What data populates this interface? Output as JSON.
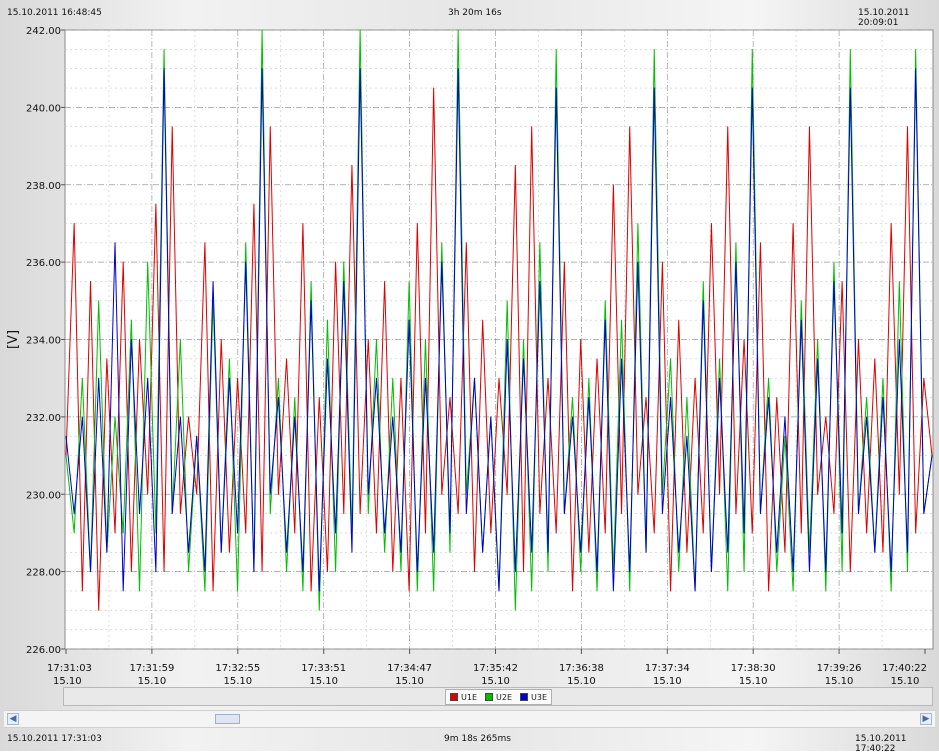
{
  "header": {
    "left_datetime": "15.10.2011 16:48:45",
    "center_duration": "3h 20m 16s",
    "right_datetime": "15.10.2011 20:09:01"
  },
  "footer": {
    "left_datetime": "15.10.2011 17:31:03",
    "center_duration": "9m 18s 265ms",
    "right_datetime": "15.10.2011 17:40:22"
  },
  "chart_data": {
    "type": "line",
    "ylabel": "[V]",
    "ylim": [
      226,
      242
    ],
    "yticks": [
      "226.00",
      "228.00",
      "230.00",
      "232.00",
      "234.00",
      "236.00",
      "238.00",
      "240.00",
      "242.00"
    ],
    "xticks": [
      {
        "time": "17:31:03",
        "date": "15.10"
      },
      {
        "time": "17:31:59",
        "date": "15.10"
      },
      {
        "time": "17:32:55",
        "date": "15.10"
      },
      {
        "time": "17:33:51",
        "date": "15.10"
      },
      {
        "time": "17:34:47",
        "date": "15.10"
      },
      {
        "time": "17:35:42",
        "date": "15.10"
      },
      {
        "time": "17:36:38",
        "date": "15.10"
      },
      {
        "time": "17:37:34",
        "date": "15.10"
      },
      {
        "time": "17:38:30",
        "date": "15.10"
      },
      {
        "time": "17:39:26",
        "date": "15.10"
      },
      {
        "time": "17:40:22",
        "date": "15.10"
      }
    ],
    "grid": true,
    "legend_position": "bottom-center",
    "series": [
      {
        "name": "U1E",
        "color": "#e00000",
        "values": [
          231,
          237,
          227.5,
          235.5,
          227,
          233.5,
          229,
          236,
          228,
          234,
          230,
          237.5,
          228,
          239.5,
          229.5,
          232,
          230,
          236.5,
          227.5,
          234,
          228.5,
          233,
          229,
          237.5,
          228,
          239.5,
          230,
          233.5,
          229,
          237,
          227.5,
          232.5,
          228,
          236,
          229.5,
          238.5,
          229.5,
          234,
          229,
          235.5,
          228,
          233,
          227.5,
          237,
          229,
          240.5,
          230,
          232.5,
          229.5,
          236.5,
          228,
          234.5,
          229,
          233,
          230,
          238.5,
          228,
          239.5,
          229.5,
          233,
          229,
          236,
          227.5,
          234,
          228.5,
          233.5,
          229,
          238,
          229.5,
          239.5,
          230,
          232.5,
          229,
          236,
          227.5,
          234.5,
          228.5,
          233,
          229,
          237,
          230,
          239.5,
          229.5,
          234,
          229,
          236.5,
          227.5,
          232.5,
          228.5,
          237,
          229,
          239.5,
          230,
          232,
          229.5,
          235.5,
          228,
          234,
          229,
          233.5,
          228.5,
          237,
          230,
          239.5,
          229,
          233,
          231
        ]
      },
      {
        "name": "U2E",
        "color": "#00c000",
        "values": [
          231,
          229,
          233,
          228,
          235,
          228.5,
          232,
          229,
          234.5,
          227.5,
          236,
          229,
          241.5,
          229.5,
          234,
          228,
          231.5,
          227.5,
          235,
          228.5,
          233.5,
          227.5,
          236.5,
          228,
          242,
          229.5,
          233,
          228,
          232.5,
          227.5,
          235.5,
          227,
          234.5,
          228,
          236,
          229,
          242,
          229.5,
          234,
          228.5,
          233,
          228,
          235.5,
          227.5,
          234,
          227.5,
          236.5,
          228.5,
          242,
          230,
          233,
          228.5,
          232,
          227.5,
          235,
          227,
          234,
          227.5,
          236.5,
          228,
          241.5,
          229.5,
          232.5,
          228,
          233,
          227.5,
          235,
          228,
          234.5,
          227.5,
          237,
          228.5,
          241.5,
          230,
          233.5,
          228,
          232.5,
          227.5,
          235.5,
          228,
          233.5,
          227.5,
          236.5,
          228,
          241.5,
          229.5,
          233,
          228,
          231.5,
          227.5,
          235,
          228.5,
          234,
          227.5,
          236,
          228,
          241.5,
          229.5,
          232.5,
          228.5,
          233,
          227.5,
          235.5,
          228,
          241.5,
          229.5,
          231
        ]
      },
      {
        "name": "U3E",
        "color": "#0000d0",
        "values": [
          231.5,
          229.5,
          232,
          228,
          233,
          228.5,
          236.5,
          227.5,
          234,
          229.5,
          233,
          228,
          241,
          229.5,
          232,
          228.5,
          231.5,
          228,
          235.5,
          228.5,
          233,
          229,
          236,
          228,
          241,
          230,
          232.5,
          228.5,
          232,
          228,
          235,
          227.5,
          233.5,
          229,
          235.5,
          228.5,
          241,
          230,
          233,
          229,
          232,
          228.5,
          234.5,
          228,
          233,
          228.5,
          236,
          229,
          241,
          229.5,
          233,
          228.5,
          232,
          227.5,
          234,
          228,
          233.5,
          228.5,
          235.5,
          228.5,
          240.5,
          229.5,
          232,
          228.5,
          232.5,
          228,
          234.5,
          227.5,
          233.5,
          228,
          236,
          228.5,
          240.5,
          229.5,
          232.5,
          228.5,
          231.5,
          227.5,
          235,
          228,
          233,
          228.5,
          236,
          229,
          240.5,
          229.5,
          232.5,
          228.5,
          232,
          228,
          234.5,
          228,
          233.5,
          228,
          235.5,
          229,
          240.5,
          229.5,
          232,
          228.5,
          232.5,
          228,
          234,
          228.5,
          241,
          229.5,
          231
        ]
      }
    ]
  }
}
